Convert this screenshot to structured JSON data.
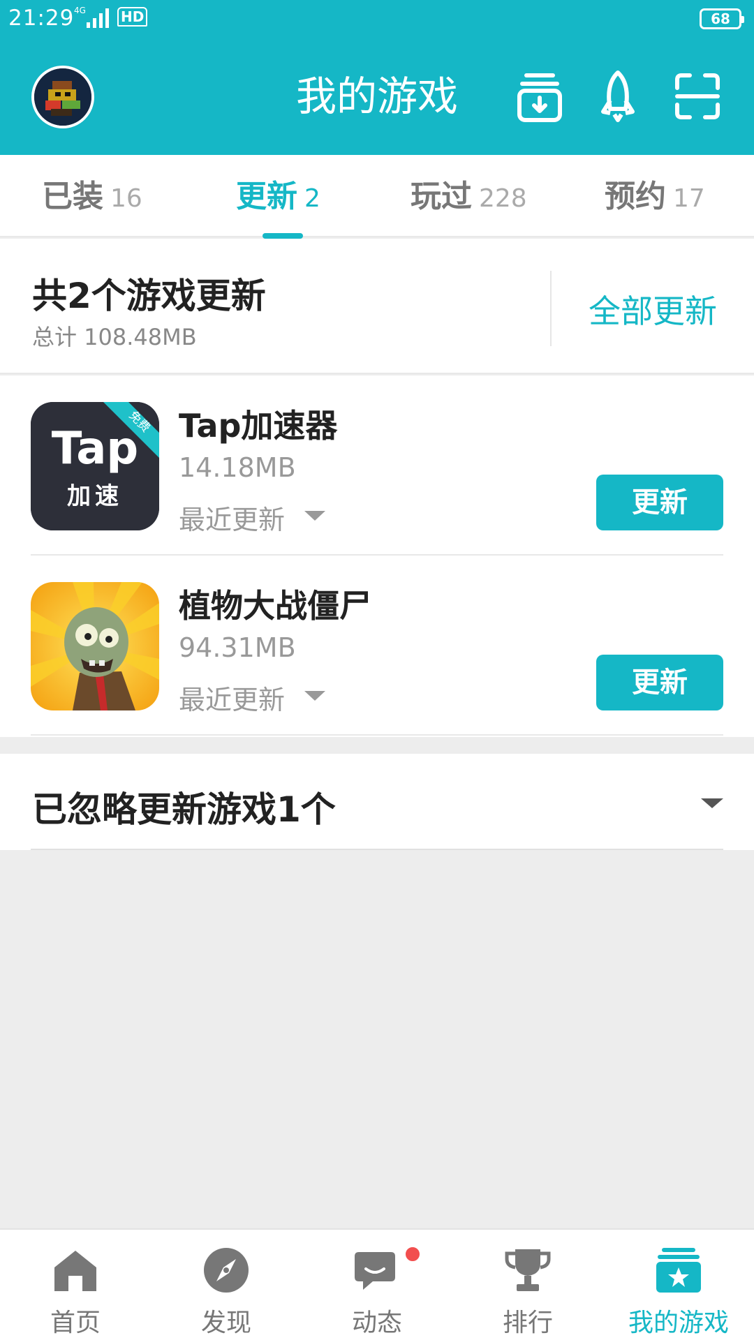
{
  "status_bar": {
    "time": "21:29",
    "network": "4G",
    "hd": "HD",
    "battery": "68"
  },
  "header": {
    "title": "我的游戏"
  },
  "tabs": [
    {
      "label": "已装",
      "count": "16"
    },
    {
      "label": "更新",
      "count": "2"
    },
    {
      "label": "玩过",
      "count": "228"
    },
    {
      "label": "预约",
      "count": "17"
    }
  ],
  "summary": {
    "title": "共2个游戏更新",
    "total_size": "总计  108.48MB",
    "update_all_label": "全部更新"
  },
  "games": [
    {
      "name": "Tap加速器",
      "size": "14.18MB",
      "recent": "最近更新",
      "button": "更新",
      "icon_text": "Tap",
      "icon_subtext": "加速",
      "ribbon": "免费"
    },
    {
      "name": "植物大战僵尸",
      "size": "94.31MB",
      "recent": "最近更新",
      "button": "更新"
    }
  ],
  "ignored": {
    "label": "已忽略更新游戏1个"
  },
  "bottom_nav": [
    {
      "label": "首页",
      "icon": "home-icon"
    },
    {
      "label": "发现",
      "icon": "compass-icon"
    },
    {
      "label": "动态",
      "icon": "chat-icon"
    },
    {
      "label": "排行",
      "icon": "trophy-icon"
    },
    {
      "label": "我的游戏",
      "icon": "my-games-icon"
    }
  ],
  "colors": {
    "accent": "#15b7c6",
    "background": "#ededed",
    "badge": "#f24e4e"
  }
}
